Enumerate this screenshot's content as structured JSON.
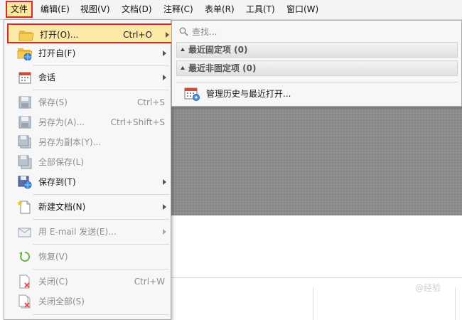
{
  "menubar": {
    "items": [
      "文件",
      "编辑(E)",
      "视图(V)",
      "文档(D)",
      "注释(C)",
      "表单(R)",
      "工具(T)",
      "窗口(W)"
    ]
  },
  "file_menu": {
    "items": [
      {
        "label": "打开(O)...",
        "shortcut": "Ctrl+O",
        "icon": "folder-open-icon"
      },
      {
        "label": "打开自(F)",
        "icon": "folder-globe-icon"
      },
      {
        "label": "会话",
        "icon": "calendar-icon"
      },
      {
        "label": "保存(S)",
        "shortcut": "Ctrl+S",
        "icon": "save-icon"
      },
      {
        "label": "另存为(A)...",
        "shortcut": "Ctrl+Shift+S",
        "icon": "save-as-icon"
      },
      {
        "label": "另存为副本(Y)...",
        "icon": "save-copy-icon"
      },
      {
        "label": "全部保存(L)",
        "icon": "save-all-icon"
      },
      {
        "label": "保存到(T)",
        "icon": "save-to-icon"
      },
      {
        "label": "新建文档(N)",
        "icon": "new-document-icon"
      },
      {
        "label": "用 E-mail 发送(E)...",
        "icon": "email-icon"
      },
      {
        "label": "恢复(V)",
        "icon": "revert-icon"
      },
      {
        "label": "关闭(C)",
        "shortcut": "Ctrl+W",
        "icon": "close-document-icon"
      },
      {
        "label": "关闭全部(S)",
        "icon": "close-all-icon"
      }
    ]
  },
  "open_submenu": {
    "search_placeholder": "查找...",
    "pinned_label": "最近固定项 (0)",
    "unpinned_label": "最近非固定项 (0)",
    "manage_label": "管理历史与最近打开..."
  },
  "watermark": "@经验",
  "colors": {
    "highlight_border": "#e0262b",
    "highlight_fill": "#fde9a6",
    "viewer_bg": "#8d8d8d"
  }
}
